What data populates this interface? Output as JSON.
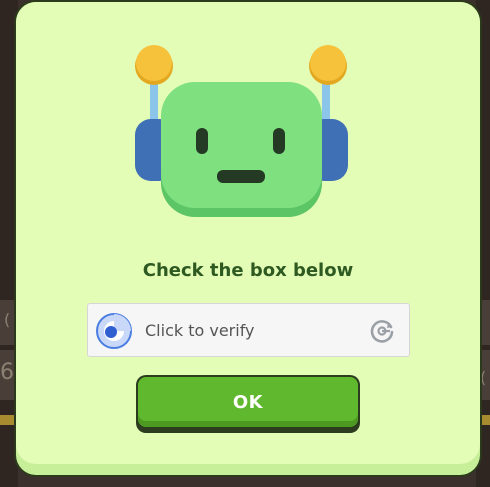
{
  "modal": {
    "title": "Check the box below",
    "captcha": {
      "label": "Click to verify",
      "checkbox_icon": "recaptcha-checkbox-icon",
      "logo_icon": "recaptcha-logo-icon"
    },
    "ok_button_label": "OK"
  },
  "illustration": {
    "name": "robot-illustration",
    "head_color": "#7ee07f",
    "antenna_ball_color": "#f6c23b",
    "ear_color": "#3f6fb5"
  },
  "background": {
    "glyph_left_top": "(",
    "glyph_left_mid": "6",
    "glyph_right_mid": "(",
    "accent_color": "#a88b2f"
  },
  "colors": {
    "modal_fill": "#e3fcb6",
    "title_color": "#2e5a22",
    "ok_button": "#5fb82d"
  }
}
